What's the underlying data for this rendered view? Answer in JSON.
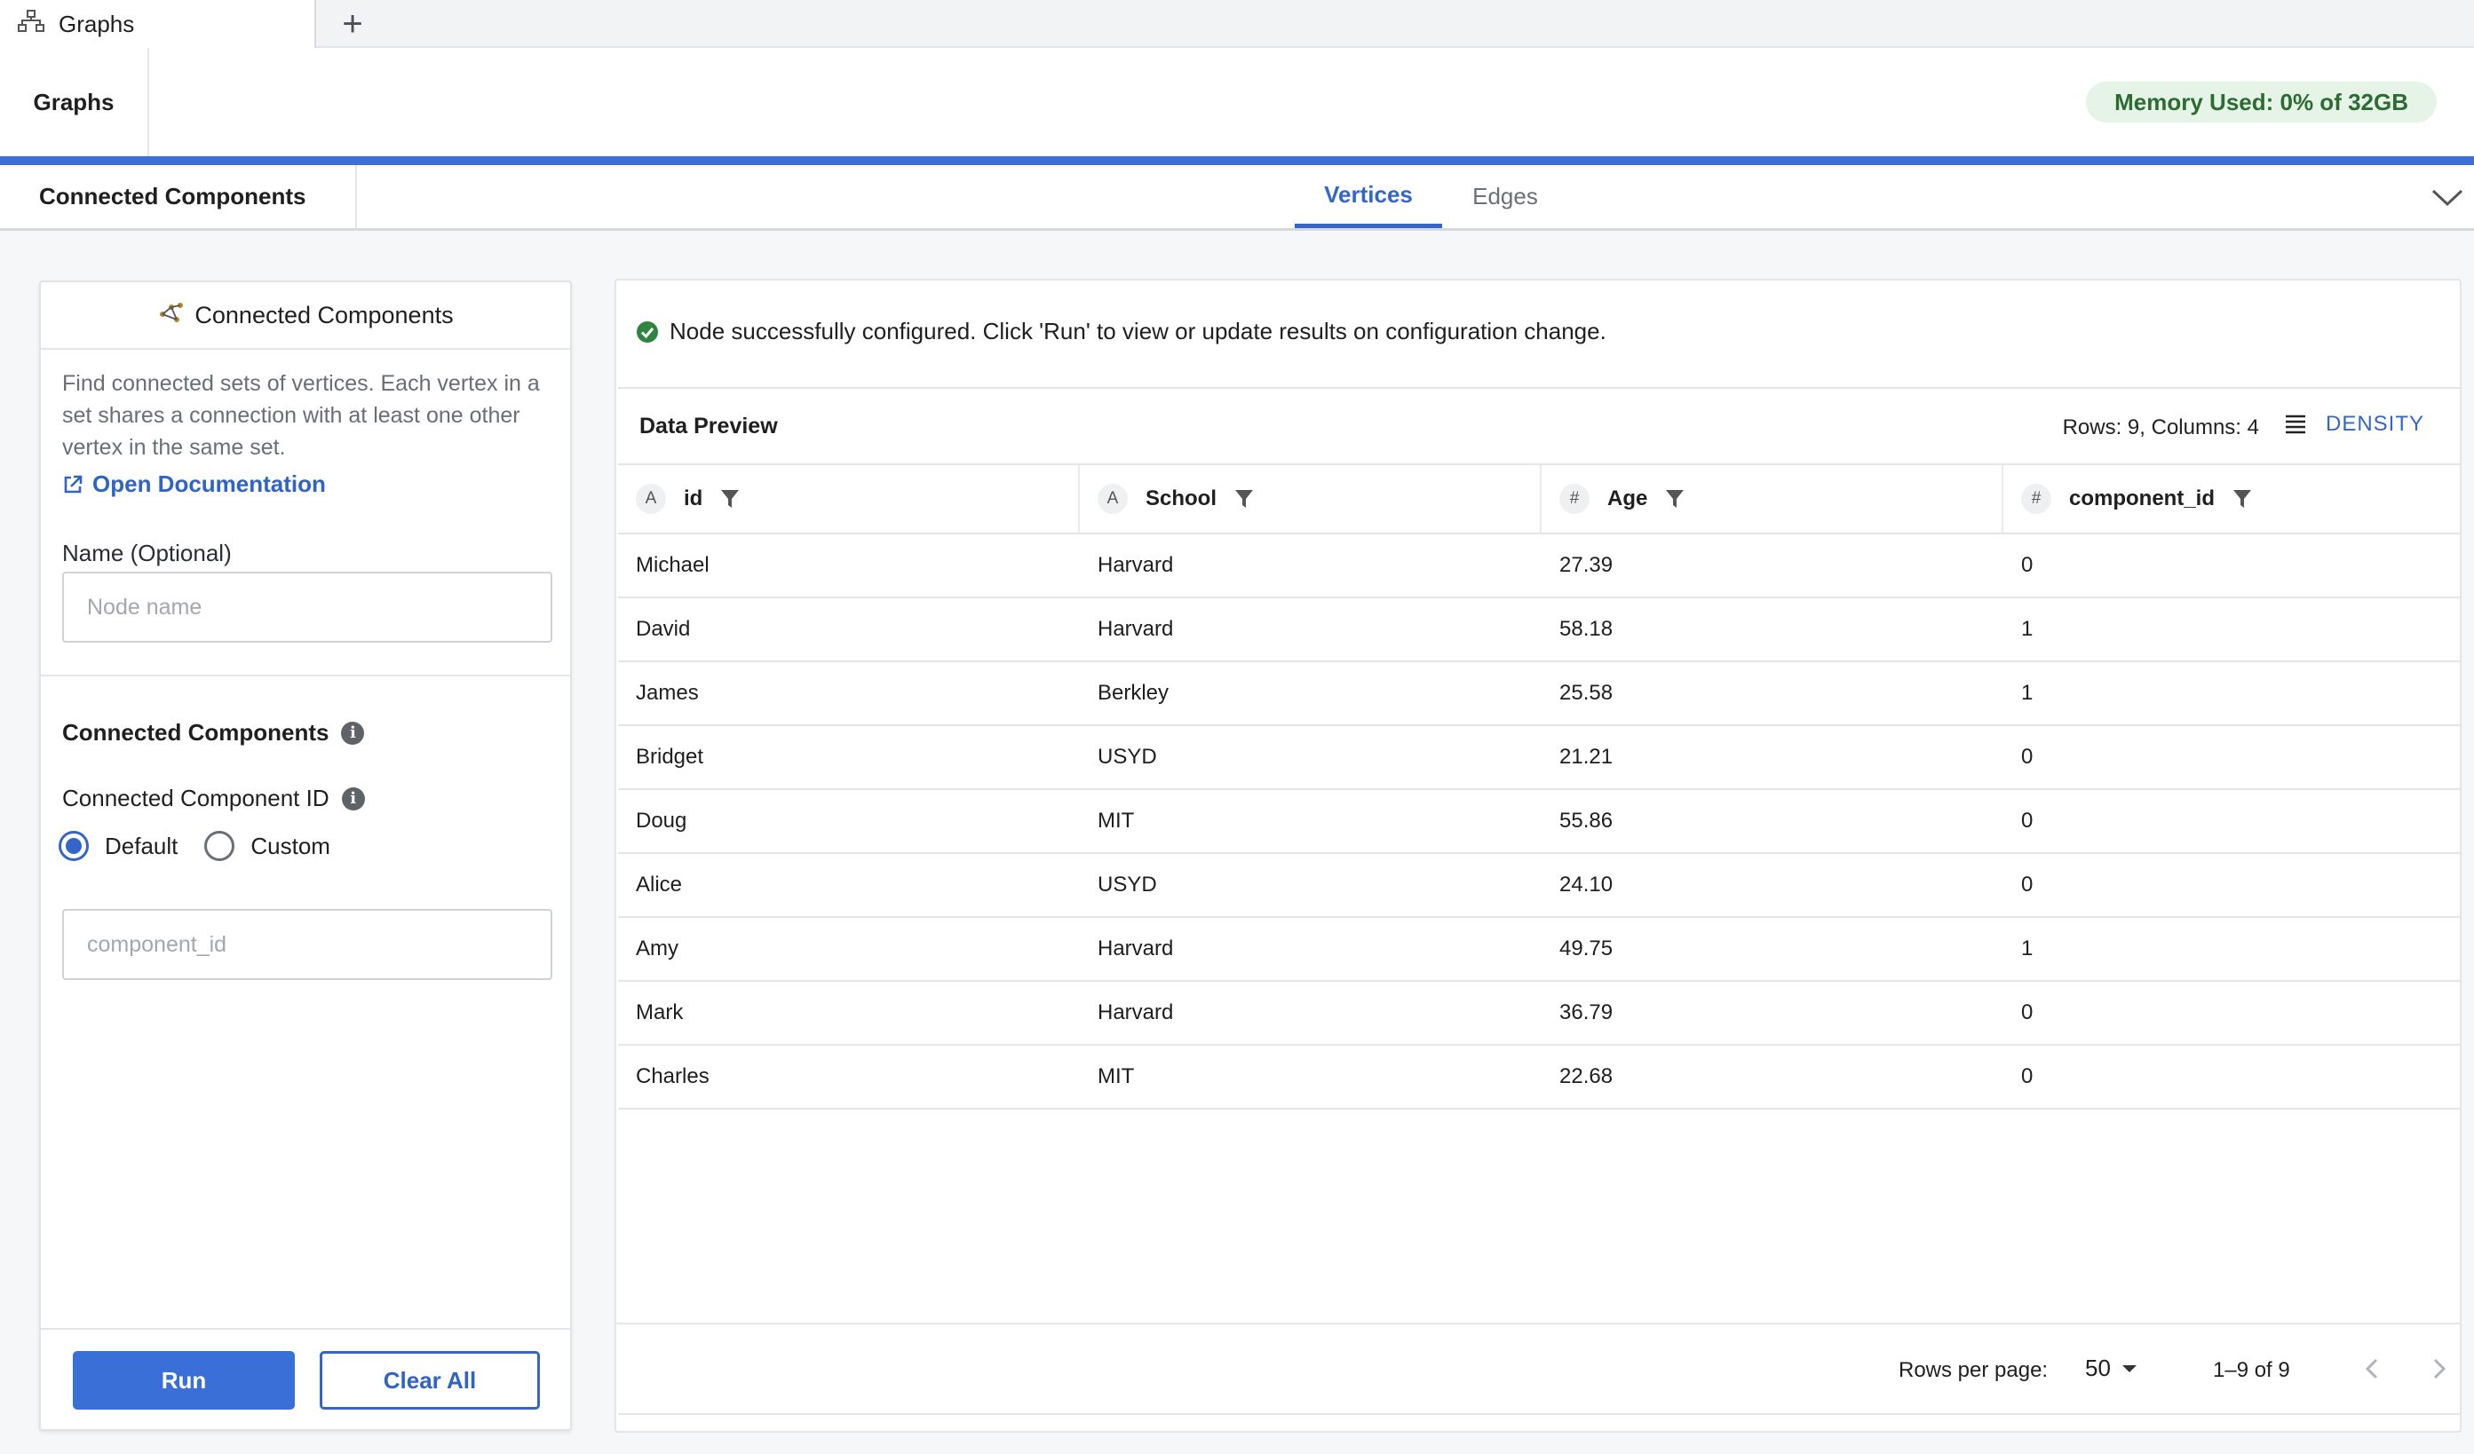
{
  "browser_tab": {
    "label": "Graphs",
    "icon": "graph-icon",
    "add_icon": "plus-icon"
  },
  "header": {
    "title": "Graphs",
    "memory_badge": "Memory Used: 0% of 32GB",
    "colors": {
      "accent_bar": "#3f6fd4",
      "badge_bg": "#e6f4e7",
      "badge_text": "#2c6b32"
    }
  },
  "node_tabs": {
    "node_label": "Connected Components",
    "view_tabs": [
      {
        "label": "Vertices",
        "active": true
      },
      {
        "label": "Edges",
        "active": false
      }
    ],
    "collapse_icon": "chevron-down-icon"
  },
  "left_panel": {
    "title": "Connected Components",
    "title_icon": "connected-components-icon",
    "description": "Find connected sets of vertices. Each vertex in a set shares a connection with at least one other vertex in the same set.",
    "docs_link": "Open Documentation",
    "name_label": "Name (Optional)",
    "name_placeholder": "Node name",
    "name_value": "",
    "section_title": "Connected Components",
    "cc_id_label": "Connected Component ID",
    "radio_options": [
      {
        "label": "Default",
        "checked": true
      },
      {
        "label": "Custom",
        "checked": false
      }
    ],
    "cc_id_placeholder": "component_id",
    "run_label": "Run",
    "clear_label": "Clear All"
  },
  "right_panel": {
    "status_message": "Node successfully configured. Click 'Run' to view or update results on configuration change.",
    "preview_title": "Data Preview",
    "rows_cols": "Rows: 9, Columns: 4",
    "density_label": "DENSITY",
    "columns": [
      {
        "name": "id",
        "type": "A"
      },
      {
        "name": "School",
        "type": "A"
      },
      {
        "name": "Age",
        "type": "#"
      },
      {
        "name": "component_id",
        "type": "#"
      }
    ],
    "rows": [
      [
        "Michael",
        "Harvard",
        "27.39",
        "0"
      ],
      [
        "David",
        "Harvard",
        "58.18",
        "1"
      ],
      [
        "James",
        "Berkley",
        "25.58",
        "1"
      ],
      [
        "Bridget",
        "USYD",
        "21.21",
        "0"
      ],
      [
        "Doug",
        "MIT",
        "55.86",
        "0"
      ],
      [
        "Alice",
        "USYD",
        "24.10",
        "0"
      ],
      [
        "Amy",
        "Harvard",
        "49.75",
        "1"
      ],
      [
        "Mark",
        "Harvard",
        "36.79",
        "0"
      ],
      [
        "Charles",
        "MIT",
        "22.68",
        "0"
      ]
    ],
    "pagination": {
      "rows_per_page_label": "Rows per page:",
      "rows_per_page_value": "50",
      "page_info": "1–9 of 9"
    }
  }
}
